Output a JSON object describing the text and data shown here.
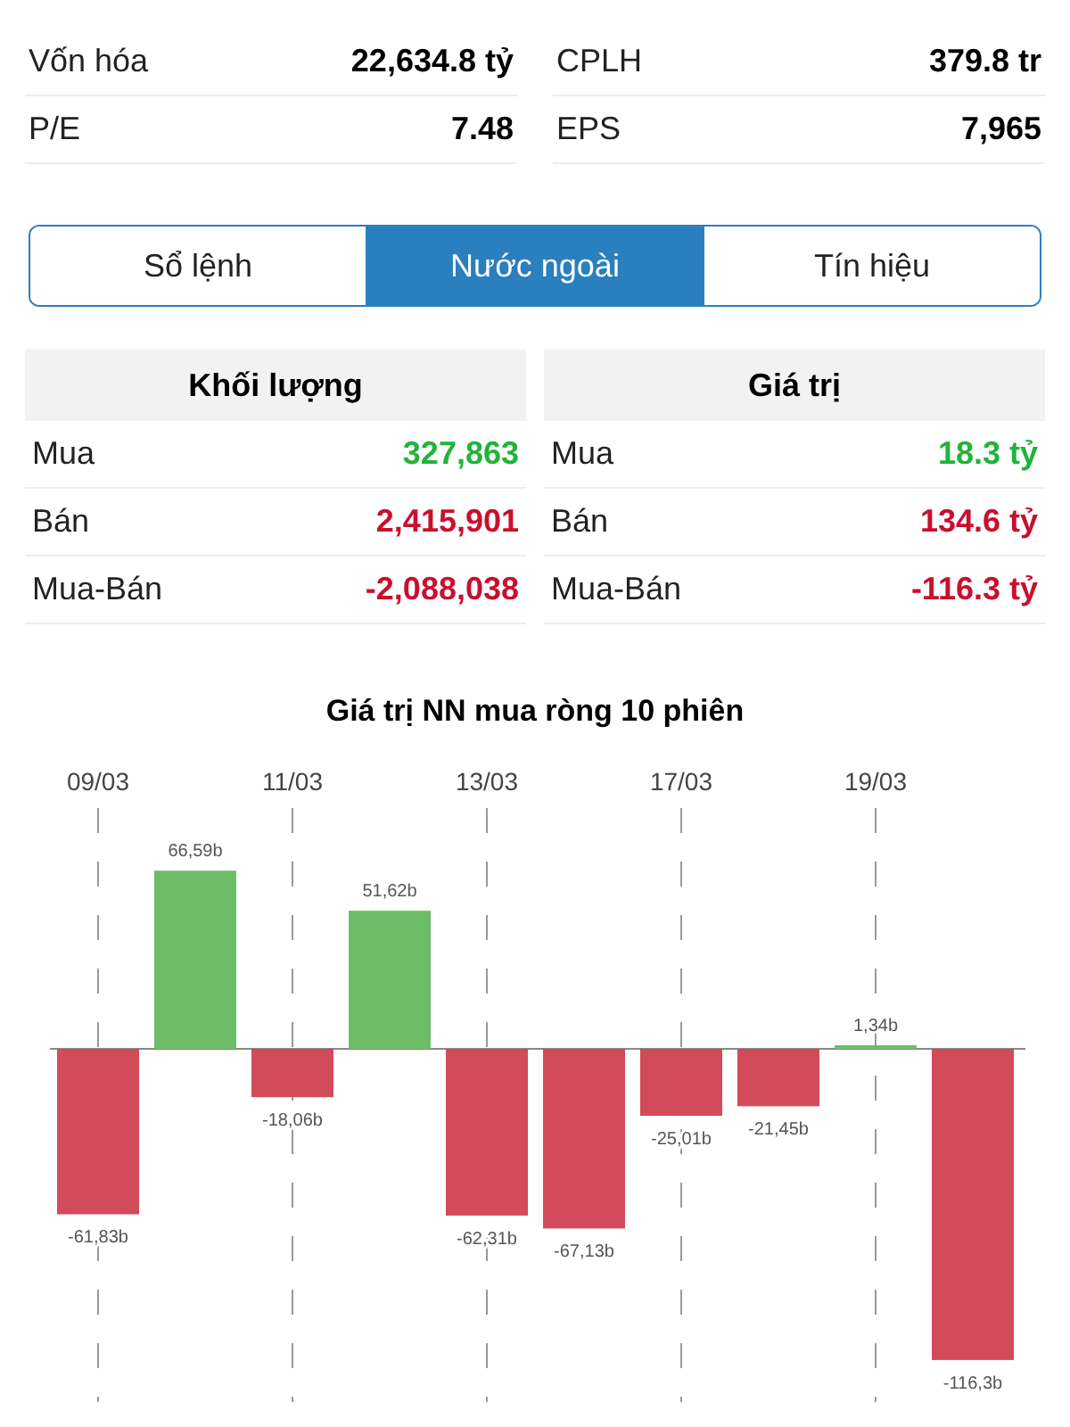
{
  "stats": [
    {
      "label": "Vốn hóa",
      "value": "22,634.8 tỷ"
    },
    {
      "label": "CPLH",
      "value": "379.8 tr"
    },
    {
      "label": "P/E",
      "value": "7.48"
    },
    {
      "label": "EPS",
      "value": "7,965"
    }
  ],
  "tabs": [
    {
      "label": "Sổ lệnh",
      "selected": false
    },
    {
      "label": "Nước ngoài",
      "selected": true
    },
    {
      "label": "Tín hiệu",
      "selected": false
    }
  ],
  "foreign": [
    {
      "heading": "Khối lượng",
      "rows": [
        {
          "label": "Mua",
          "value": "327,863",
          "color": "#22b33a"
        },
        {
          "label": "Bán",
          "value": "2,415,901",
          "color": "#c8102e"
        },
        {
          "label": "Mua-Bán",
          "value": "-2,088,038",
          "color": "#c8102e"
        }
      ]
    },
    {
      "heading": "Giá trị",
      "rows": [
        {
          "label": "Mua",
          "value": "18.3 tỷ",
          "color": "#22b33a"
        },
        {
          "label": "Bán",
          "value": "134.6 tỷ",
          "color": "#c8102e"
        },
        {
          "label": "Mua-Bán",
          "value": "-116.3 tỷ",
          "color": "#c8102e"
        }
      ]
    }
  ],
  "chart": {
    "chart_data": {
      "type": "bar",
      "title": "Giá trị NN mua ròng 10 phiên",
      "grid": true,
      "categories": [
        "09/03",
        null,
        "11/03",
        null,
        "13/03",
        null,
        "17/03",
        null,
        "19/03",
        null
      ],
      "values": [
        -61.83,
        66.59,
        -18.06,
        51.62,
        -62.31,
        -67.13,
        -25.01,
        -21.45,
        1.34,
        -116.3
      ],
      "value_labels": [
        "-61,83b",
        "66,59b",
        "-18,06b",
        "51,62b",
        "-62,31b",
        "-67,13b",
        "-25,01b",
        "-21,45b",
        "1,34b",
        "-116,3b"
      ]
    }
  }
}
